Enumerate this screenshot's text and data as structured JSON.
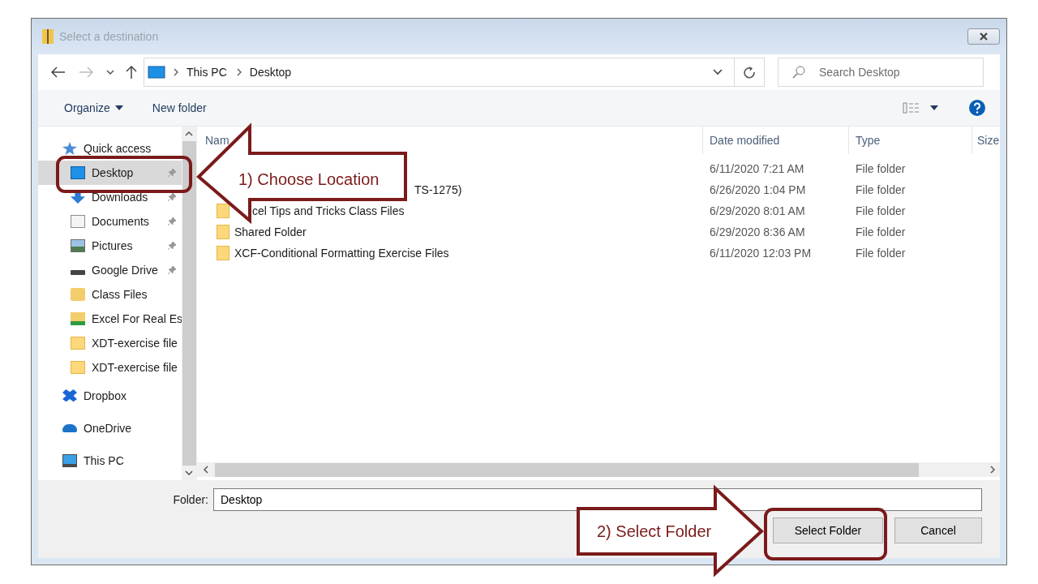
{
  "window": {
    "title": "Select a destination"
  },
  "address_bar": {
    "path": [
      "This PC",
      "Desktop"
    ]
  },
  "search": {
    "placeholder": "Search Desktop"
  },
  "toolbar": {
    "organize": "Organize",
    "new_folder": "New folder"
  },
  "sidebar": {
    "items": [
      {
        "label": "Quick access",
        "kind": "star",
        "pinned": false,
        "selected": false,
        "children": [
          {
            "label": "Desktop",
            "kind": "desktop",
            "pinned": true,
            "selected": true
          },
          {
            "label": "Downloads",
            "kind": "download",
            "pinned": true,
            "selected": false
          },
          {
            "label": "Documents",
            "kind": "document",
            "pinned": true,
            "selected": false
          },
          {
            "label": "Pictures",
            "kind": "pictures",
            "pinned": true,
            "selected": false
          },
          {
            "label": "Google Drive",
            "kind": "drive",
            "pinned": true,
            "selected": false
          },
          {
            "label": "Class Files",
            "kind": "user-folder",
            "pinned": false,
            "selected": false
          },
          {
            "label": "Excel For Real Es",
            "kind": "synced-folder",
            "pinned": false,
            "selected": false
          },
          {
            "label": "XDT-exercise file",
            "kind": "folder",
            "pinned": false,
            "selected": false
          },
          {
            "label": "XDT-exercise file",
            "kind": "folder",
            "pinned": false,
            "selected": false
          }
        ]
      },
      {
        "label": "Dropbox",
        "kind": "dropbox",
        "pinned": false,
        "selected": false
      },
      {
        "label": "OneDrive",
        "kind": "cloud",
        "pinned": false,
        "selected": false
      },
      {
        "label": "This PC",
        "kind": "pc",
        "pinned": false,
        "selected": false
      }
    ]
  },
  "table": {
    "columns": [
      "Nam",
      "Date modified",
      "Type",
      "Size"
    ],
    "rows": [
      {
        "kind": "hidden",
        "date": "6/11/2020 7:21 AM",
        "type": "File folder"
      },
      {
        "kind": "cut_far",
        "name": "TS-1275)",
        "date": "6/26/2020 1:04 PM",
        "type": "File folder"
      },
      {
        "kind": "cut_near",
        "name": "cel Tips and Tricks Class Files",
        "date": "6/29/2020 8:01 AM",
        "type": "File folder"
      },
      {
        "kind": "full",
        "name": "Shared Folder",
        "date": "6/29/2020 8:36 AM",
        "type": "File folder"
      },
      {
        "kind": "full",
        "name": "XCF-Conditional Formatting Exercise Files",
        "date": "6/11/2020 12:03 PM",
        "type": "File folder"
      }
    ]
  },
  "folder_field": {
    "label": "Folder:",
    "value": "Desktop"
  },
  "buttons": [
    "Select Folder",
    "Cancel"
  ],
  "callouts": [
    {
      "text": "1) Choose Location"
    },
    {
      "text": "2) Select Folder"
    }
  ]
}
